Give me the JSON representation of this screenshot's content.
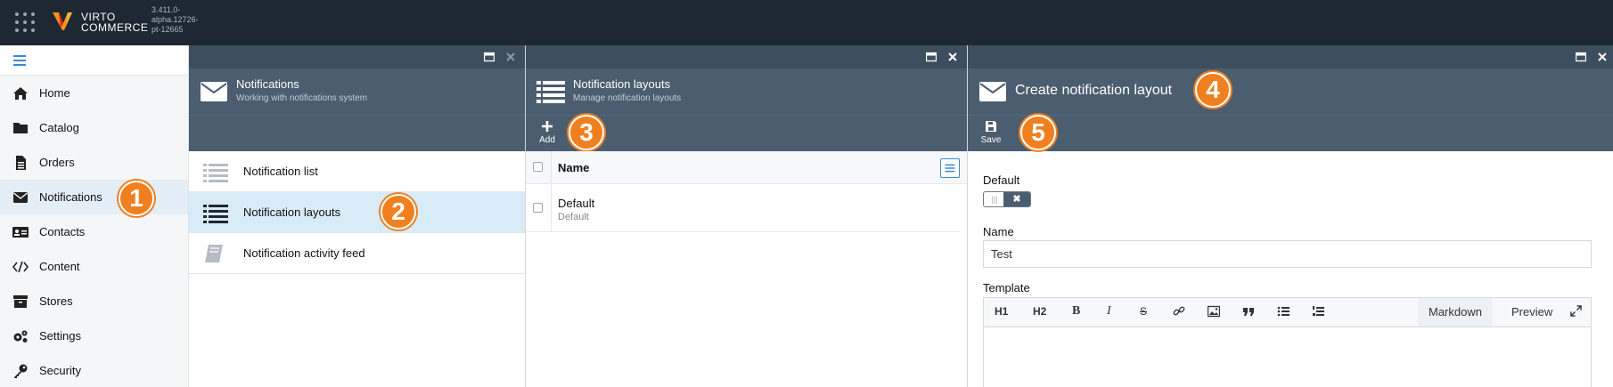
{
  "topbar": {
    "logo_line1": "VIRTO",
    "logo_line2": "COMMERCE",
    "version": "3.411.0-alpha.12726-pt-12665"
  },
  "nav": {
    "items": [
      {
        "label": "Home",
        "icon": "home-icon"
      },
      {
        "label": "Catalog",
        "icon": "folder-icon"
      },
      {
        "label": "Orders",
        "icon": "file-icon"
      },
      {
        "label": "Notifications",
        "icon": "envelope-icon"
      },
      {
        "label": "Contacts",
        "icon": "id-card-icon"
      },
      {
        "label": "Content",
        "icon": "code-icon"
      },
      {
        "label": "Stores",
        "icon": "archive-icon"
      },
      {
        "label": "Settings",
        "icon": "gears-icon"
      },
      {
        "label": "Security",
        "icon": "key-icon"
      }
    ],
    "active": "Notifications"
  },
  "blade1": {
    "title": "Notifications",
    "subtitle": "Working with notifications system",
    "items": [
      {
        "label": "Notification list"
      },
      {
        "label": "Notification layouts"
      },
      {
        "label": "Notification activity feed"
      }
    ]
  },
  "blade2": {
    "title": "Notification layouts",
    "subtitle": "Manage notification layouts",
    "add_label": "Add",
    "column_name": "Name",
    "rows": [
      {
        "name": "Default",
        "sub": "Default"
      }
    ]
  },
  "blade3": {
    "title": "Create notification layout",
    "save_label": "Save",
    "default_label": "Default",
    "name_label": "Name",
    "name_value": "Test",
    "template_label": "Template",
    "editor": {
      "h1": "H1",
      "h2": "H2",
      "bold": "B",
      "italic": "I",
      "strike": "S",
      "markdown_tab": "Markdown",
      "preview_tab": "Preview"
    }
  },
  "badges": [
    "1",
    "2",
    "3",
    "4",
    "5"
  ],
  "colors": {
    "topbar": "#1e2832",
    "blade_header": "#4b5e70",
    "accent": "#3a8ad8",
    "badge": "#f07f1f",
    "active_row": "#d8ecf7"
  }
}
